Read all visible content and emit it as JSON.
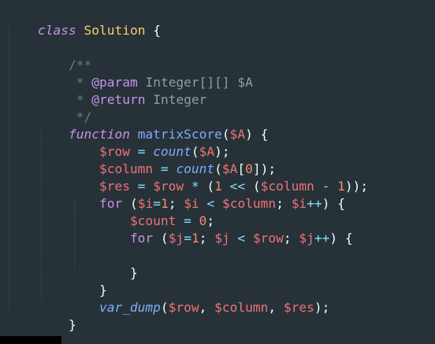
{
  "code": {
    "kw_class": "class",
    "class_name": "Solution",
    "brace_open": "{",
    "brace_close": "}",
    "doc_open": "/**",
    "doc_star": " *",
    "doc_param_tag": "@param",
    "doc_param_type": "Integer[][]",
    "doc_param_var": "$A",
    "doc_return_tag": "@return",
    "doc_return_type": "Integer",
    "doc_close": " */",
    "kw_function": "function",
    "fn_name": "matrixScore",
    "param": "$A",
    "kw_for": "for",
    "builtin_count": "count",
    "builtin_var_dump": "var_dump",
    "var_row": "$row",
    "var_column": "$column",
    "var_res": "$res",
    "var_i": "$i",
    "var_j": "$j",
    "var_count": "$count",
    "var_A": "$A",
    "num_0": "0",
    "num_1": "1"
  }
}
